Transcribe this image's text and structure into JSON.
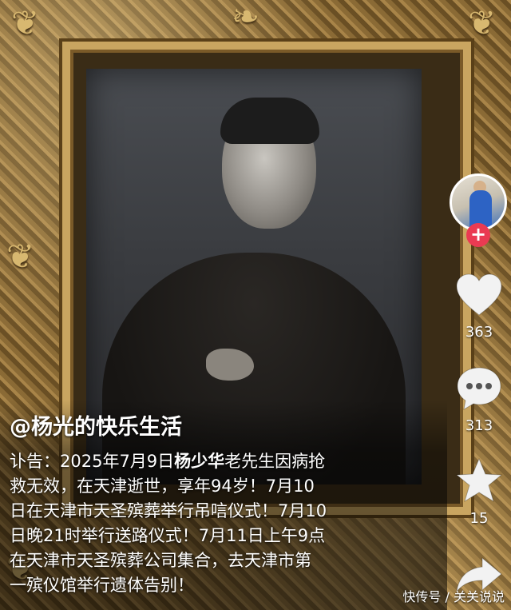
{
  "post": {
    "username": "@杨光的快乐生活",
    "caption_line1_pre": "讣告：2025年7月9日",
    "caption_name": "杨少华",
    "caption_line1_post": "老先生因病抢",
    "caption_rest": "救无效，在天津逝世，享年94岁！7月10\n日在天津市天圣殡葬举行吊唁仪式！7月10\n日晚21时举行送路仪式！7月11日上午9点\n在天津市天圣殡葬公司集合，去天津市第\n一殡仪馆举行遗体告别！"
  },
  "actions": {
    "follow_symbol": "+",
    "like_count": "363",
    "comment_count": "313",
    "favorite_count": "15"
  },
  "watermark": "快传号 / 关关说说",
  "colors": {
    "follow": "#ea3a52",
    "frame_gold": "#c9a560"
  }
}
